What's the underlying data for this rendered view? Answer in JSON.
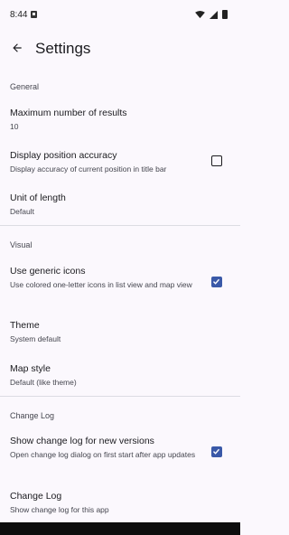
{
  "status": {
    "time": "8:44"
  },
  "header": {
    "title": "Settings"
  },
  "sections": {
    "general": {
      "label": "General",
      "max_results": {
        "title": "Maximum number of results",
        "value": "10"
      },
      "position_accuracy": {
        "title": "Display position accuracy",
        "summary": "Display accuracy of current position in title bar",
        "checked": false
      },
      "unit_of_length": {
        "title": "Unit of length",
        "value": "Default"
      }
    },
    "visual": {
      "label": "Visual",
      "generic_icons": {
        "title": "Use generic icons",
        "summary": "Use colored one-letter icons in list view and map view",
        "checked": true
      },
      "theme": {
        "title": "Theme",
        "value": "System default"
      },
      "map_style": {
        "title": "Map style",
        "value": "Default (like theme)"
      }
    },
    "changelog": {
      "label": "Change Log",
      "show_for_new": {
        "title": "Show change log for new versions",
        "summary": "Open change log dialog on first start after app updates",
        "checked": true
      },
      "change_log": {
        "title": "Change Log",
        "summary": "Show change log for this app"
      }
    }
  },
  "colors": {
    "background": "#fbf8fd",
    "accent": "#3a59a8",
    "divider": "#dcdce3"
  }
}
